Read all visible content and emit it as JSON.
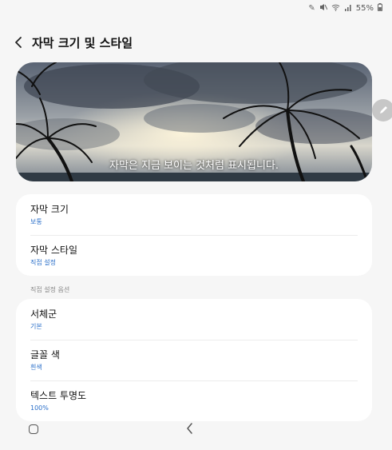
{
  "status_bar": {
    "icons": [
      "edit-icon",
      "mute-icon",
      "wifi-icon",
      "signal-icon",
      "battery-icon"
    ],
    "battery": "55%"
  },
  "header": {
    "title": "자막 크기 및 스타일"
  },
  "preview": {
    "caption": "자막은 지금 보이는 것처럼 표시됩니다."
  },
  "size_card": {
    "items": [
      {
        "title": "자막 크기",
        "value": "보통"
      },
      {
        "title": "자막 스타일",
        "value": "직접 설정"
      }
    ]
  },
  "custom_section": {
    "label": "직접 설정 옵션",
    "items": [
      {
        "title": "서체군",
        "value": "기본"
      },
      {
        "title": "글꼴 색",
        "value": "흰색"
      },
      {
        "title": "텍스트 투명도",
        "value": "100%"
      }
    ]
  },
  "colors": {
    "accent": "#2a6fc9",
    "background": "#f6f6f6",
    "card": "#ffffff"
  }
}
